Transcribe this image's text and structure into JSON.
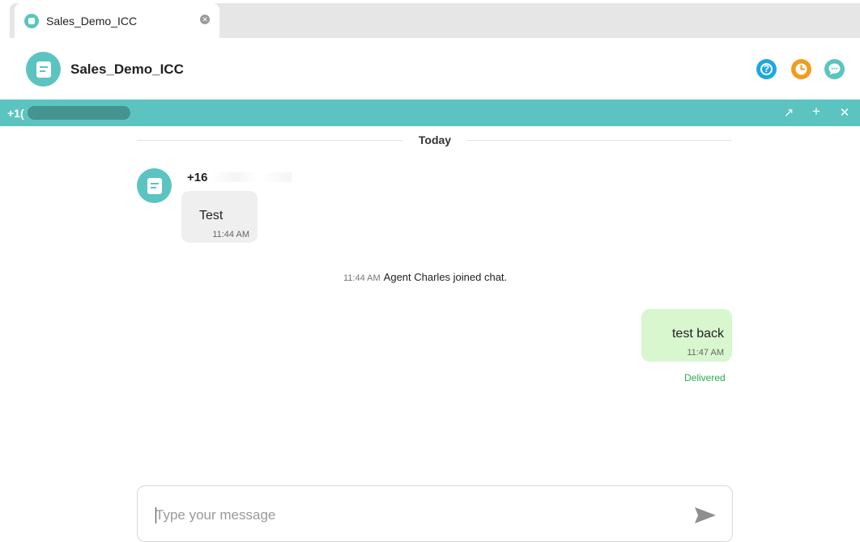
{
  "tab": {
    "title": "Sales_Demo_ICC",
    "close_glyph": "✕",
    "icon": "chat-bubble-icon"
  },
  "header": {
    "title": "Sales_Demo_ICC",
    "avatar_icon": "chat-document-icon",
    "actions": [
      {
        "name": "help-icon",
        "glyph": "?",
        "color": "#1ea7e1"
      },
      {
        "name": "clock-icon",
        "color": "#f39b1e"
      },
      {
        "name": "chat-icon",
        "color": "#5cc4c0"
      }
    ]
  },
  "conversation_bar": {
    "number": "+1(",
    "actions": {
      "forward": "↗",
      "add": "+",
      "close": "✕"
    },
    "color": "#5cc4c0"
  },
  "chat": {
    "day_label": "Today",
    "incoming": {
      "sender": "+16",
      "text": "Test",
      "time": "11:44 AM"
    },
    "system": {
      "time": "11:44 AM",
      "text": "Agent Charles joined chat."
    },
    "outgoing": {
      "text": "test back",
      "time": "11:47 AM",
      "status": "Delivered"
    }
  },
  "composer": {
    "placeholder": "Type your message",
    "value": "",
    "send_icon": "send-icon"
  },
  "colors": {
    "accent": "#5cc4c0",
    "outgoing_bubble": "#d8f7cf",
    "incoming_bubble": "#efefef",
    "delivered": "#2eaa55"
  }
}
